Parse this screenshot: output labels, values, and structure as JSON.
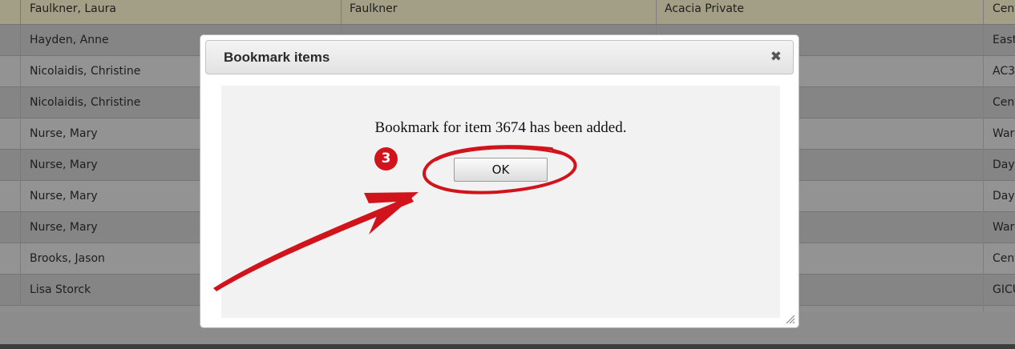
{
  "table": {
    "rows": [
      {
        "name": "Faulkner, Laura",
        "col2": "Faulkner",
        "col3": "Acacia Private",
        "col4": "Cent"
      },
      {
        "name": "Hayden, Anne",
        "col2": "",
        "col3": "",
        "col4": "East"
      },
      {
        "name": "Nicolaidis, Christine",
        "col2": "",
        "col3": "",
        "col4": "AC3"
      },
      {
        "name": "Nicolaidis, Christine",
        "col2": "",
        "col3": "",
        "col4": "Centr"
      },
      {
        "name": "Nurse, Mary",
        "col2": "",
        "col3": "",
        "col4": "Ward"
      },
      {
        "name": "Nurse, Mary",
        "col2": "",
        "col3": "",
        "col4": "Day p"
      },
      {
        "name": "Nurse, Mary",
        "col2": "",
        "col3": "",
        "col4": "Day p"
      },
      {
        "name": "Nurse, Mary",
        "col2": "",
        "col3": "",
        "col4": "Ward"
      },
      {
        "name": "Brooks, Jason",
        "col2": "",
        "col3": "",
        "col4": "Centr"
      },
      {
        "name": "Lisa Storck",
        "col2": "",
        "col3": "",
        "col4": "GICU"
      }
    ]
  },
  "dialog": {
    "title": "Bookmark items",
    "close_icon": "close-icon",
    "close_glyph": "✖",
    "message": "Bookmark for item 3674 has been added.",
    "ok_label": "OK"
  },
  "annotation": {
    "step_number": "3",
    "color": "#d1141c"
  }
}
